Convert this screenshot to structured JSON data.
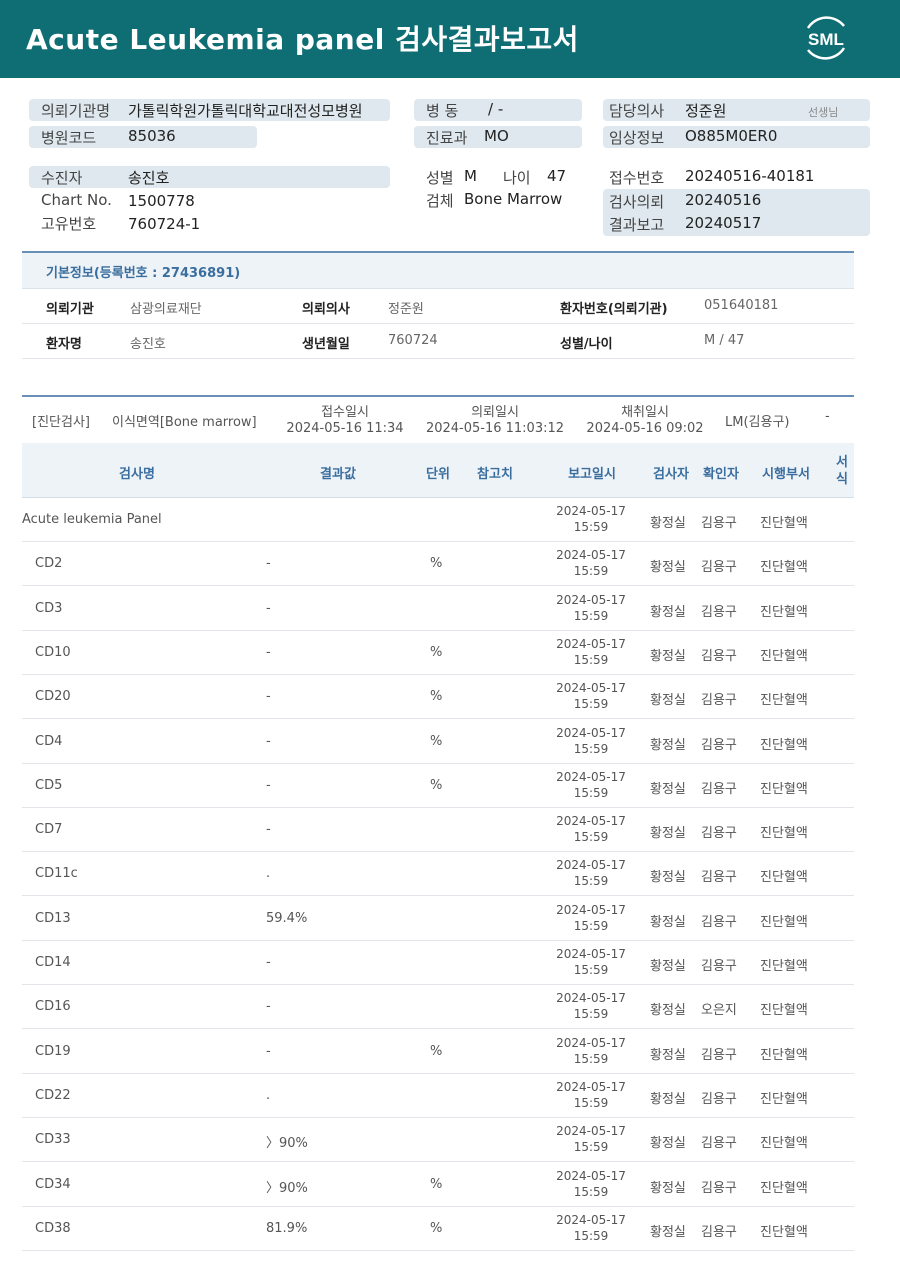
{
  "header": {
    "title": "Acute  Leukemia  panel 검사결과보고서",
    "logo_text": "SML"
  },
  "patient_info": {
    "institution_label": "의뢰기관명",
    "institution": "가톨릭학원가톨릭대학교대전성모병원",
    "hospital_code_label": "병원코드",
    "hospital_code": "85036",
    "ward_label": "병  동",
    "ward": "/ -",
    "department_label": "진료과",
    "department": "MO",
    "doctor_label": "담당의사",
    "doctor": "정준원",
    "doctor_suffix": "선생님",
    "clinical_label": "임상정보",
    "clinical": "O885M0ER0",
    "patient_label": "수진자",
    "patient": "송진호",
    "chart_label": "Chart No.",
    "chart": "1500778",
    "unique_label": "고유번호",
    "unique": "760724-1",
    "sex_label": "성별",
    "sex": "M",
    "age_label": "나이",
    "age": "47",
    "specimen_label": "검체",
    "specimen": "Bone Marrow",
    "receipt_label": "접수번호",
    "receipt": "20240516-40181",
    "request_label": "검사의뢰",
    "request": "20240516",
    "report_label": "결과보고",
    "report": "20240517"
  },
  "basic_info": {
    "section_title": "기본정보(등록번호 : 27436891)",
    "institution_label": "의뢰기관",
    "institution": "삼광의료재단",
    "doctor_label": "의뢰의사",
    "doctor": "정준원",
    "patient_no_label": "환자번호(의뢰기관)",
    "patient_no": "051640181",
    "name_label": "환자명",
    "name": "송진호",
    "birth_label": "생년월일",
    "birth": "760724",
    "sexage_label": "성별/나이",
    "sexage": "M / 47"
  },
  "order": {
    "category": "[진단검사]",
    "specimen": "이식면역[Bone marrow]",
    "received_label": "접수일시",
    "received": "2024-05-16 11:34",
    "requested_label": "의뢰일시",
    "requested": "2024-05-16 11:03:12",
    "collected_label": "채취일시",
    "collected": "2024-05-16 09:02",
    "lm": "LM(김용구)",
    "dash": "-"
  },
  "table": {
    "headers": {
      "name": "검사명",
      "result": "결과값",
      "unit": "단위",
      "reference": "참고치",
      "report_date": "보고일시",
      "tester": "검사자",
      "confirmer": "확인자",
      "dept": "시행부서",
      "form": "서식"
    },
    "rows": [
      {
        "name": "Acute leukemia Panel",
        "result": "",
        "unit": "",
        "date": "2024-05-17",
        "time": "15:59",
        "tester": "황정실",
        "confirmer": "김용구",
        "dept": "진단혈액"
      },
      {
        "name": "CD2",
        "result": "-",
        "unit": "%",
        "date": "2024-05-17",
        "time": "15:59",
        "tester": "황정실",
        "confirmer": "김용구",
        "dept": "진단혈액"
      },
      {
        "name": "CD3",
        "result": "-",
        "unit": "",
        "date": "2024-05-17",
        "time": "15:59",
        "tester": "황정실",
        "confirmer": "김용구",
        "dept": "진단혈액"
      },
      {
        "name": "CD10",
        "result": "-",
        "unit": "%",
        "date": "2024-05-17",
        "time": "15:59",
        "tester": "황정실",
        "confirmer": "김용구",
        "dept": "진단혈액"
      },
      {
        "name": "CD20",
        "result": "-",
        "unit": "%",
        "date": "2024-05-17",
        "time": "15:59",
        "tester": "황정실",
        "confirmer": "김용구",
        "dept": "진단혈액"
      },
      {
        "name": "CD4",
        "result": "-",
        "unit": "%",
        "date": "2024-05-17",
        "time": "15:59",
        "tester": "황정실",
        "confirmer": "김용구",
        "dept": "진단혈액"
      },
      {
        "name": "CD5",
        "result": "-",
        "unit": "%",
        "date": "2024-05-17",
        "time": "15:59",
        "tester": "황정실",
        "confirmer": "김용구",
        "dept": "진단혈액"
      },
      {
        "name": "CD7",
        "result": "-",
        "unit": "",
        "date": "2024-05-17",
        "time": "15:59",
        "tester": "황정실",
        "confirmer": "김용구",
        "dept": "진단혈액"
      },
      {
        "name": "CD11c",
        "result": ".",
        "unit": "",
        "date": "2024-05-17",
        "time": "15:59",
        "tester": "황정실",
        "confirmer": "김용구",
        "dept": "진단혈액"
      },
      {
        "name": "CD13",
        "result": "59.4%",
        "unit": "",
        "date": "2024-05-17",
        "time": "15:59",
        "tester": "황정실",
        "confirmer": "김용구",
        "dept": "진단혈액"
      },
      {
        "name": "CD14",
        "result": "-",
        "unit": "",
        "date": "2024-05-17",
        "time": "15:59",
        "tester": "황정실",
        "confirmer": "김용구",
        "dept": "진단혈액"
      },
      {
        "name": "CD16",
        "result": "-",
        "unit": "",
        "date": "2024-05-17",
        "time": "15:59",
        "tester": "황정실",
        "confirmer": "오은지",
        "dept": "진단혈액"
      },
      {
        "name": "CD19",
        "result": "-",
        "unit": "%",
        "date": "2024-05-17",
        "time": "15:59",
        "tester": "황정실",
        "confirmer": "김용구",
        "dept": "진단혈액"
      },
      {
        "name": "CD22",
        "result": ".",
        "unit": "",
        "date": "2024-05-17",
        "time": "15:59",
        "tester": "황정실",
        "confirmer": "김용구",
        "dept": "진단혈액"
      },
      {
        "name": "CD33",
        "result": "〉90%",
        "unit": "",
        "date": "2024-05-17",
        "time": "15:59",
        "tester": "황정실",
        "confirmer": "김용구",
        "dept": "진단혈액"
      },
      {
        "name": "CD34",
        "result": "〉90%",
        "unit": "%",
        "date": "2024-05-17",
        "time": "15:59",
        "tester": "황정실",
        "confirmer": "김용구",
        "dept": "진단혈액"
      },
      {
        "name": "CD38",
        "result": "81.9%",
        "unit": "%",
        "date": "2024-05-17",
        "time": "15:59",
        "tester": "황정실",
        "confirmer": "김용구",
        "dept": "진단혈액"
      }
    ]
  }
}
